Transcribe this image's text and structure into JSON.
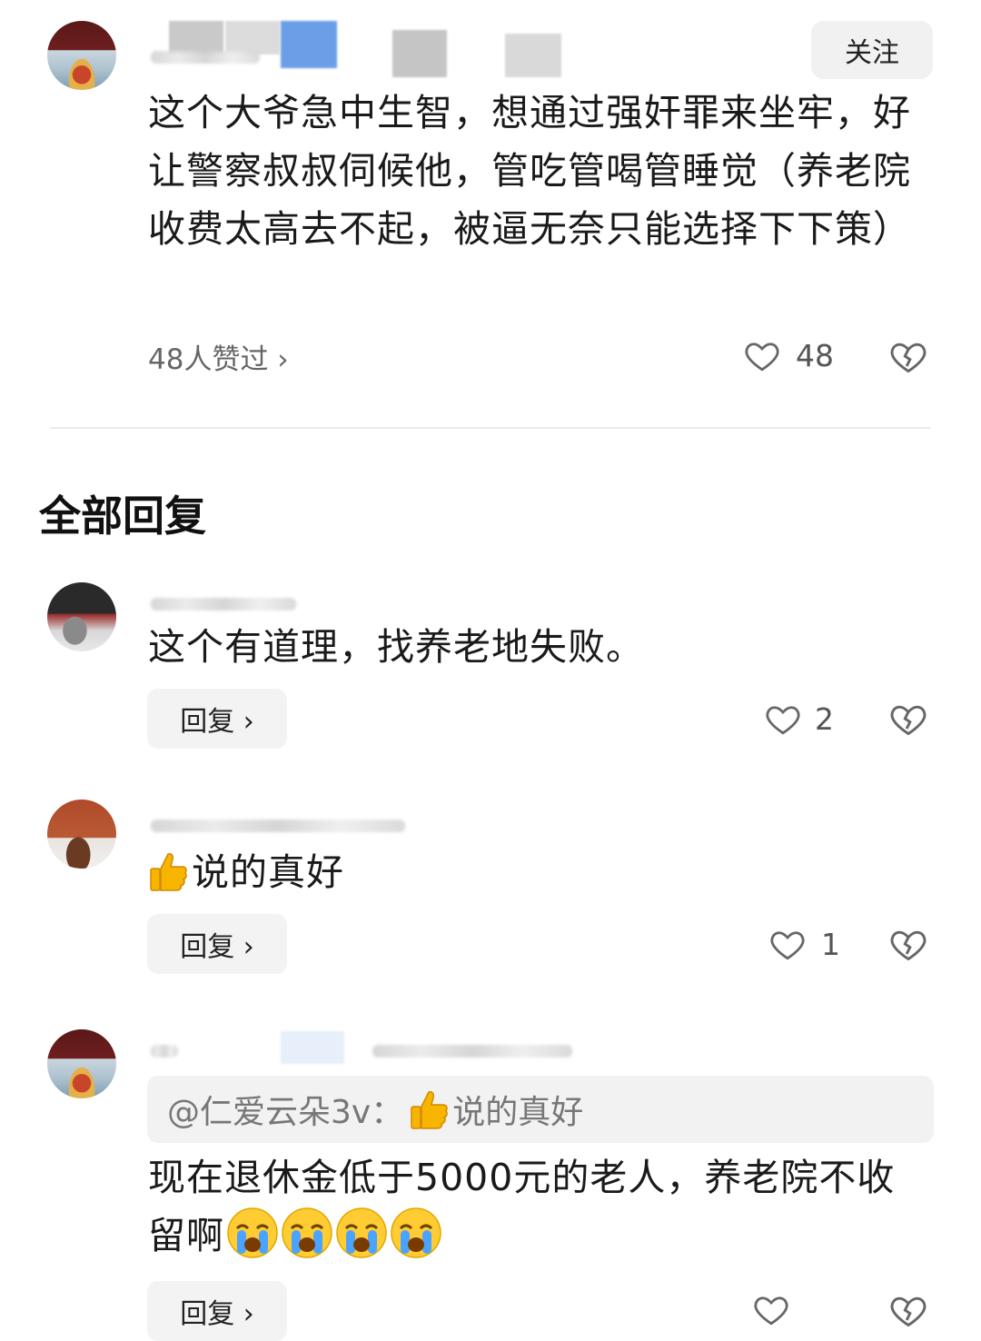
{
  "main_comment": {
    "follow_label": "关注",
    "text": "这个大爷急中生智，想通过强奸罪来坐牢，好让警察叔叔伺候他，管吃管喝管睡觉（养老院收费太高去不起，被逼无奈只能选择下下策）",
    "likers_text": "48人赞过 ›",
    "like_count": "48"
  },
  "section_title": "全部回复",
  "replies": [
    {
      "text": "这个有道理，找养老地失败。",
      "reply_label": "回复 ›",
      "like_count": "2"
    },
    {
      "text": "说的真好",
      "reply_label": "回复 ›",
      "like_count": "1"
    },
    {
      "quote_text": "@仁爱云朵3v：",
      "quote_tail": "说的真好",
      "text": "现在退休金低于5000元的老人，养老院不收留啊",
      "reply_label": "回复 ›"
    }
  ],
  "colors": {
    "divider": "#ececec",
    "button_bg": "#f3f3f3",
    "muted_text": "#666666"
  }
}
